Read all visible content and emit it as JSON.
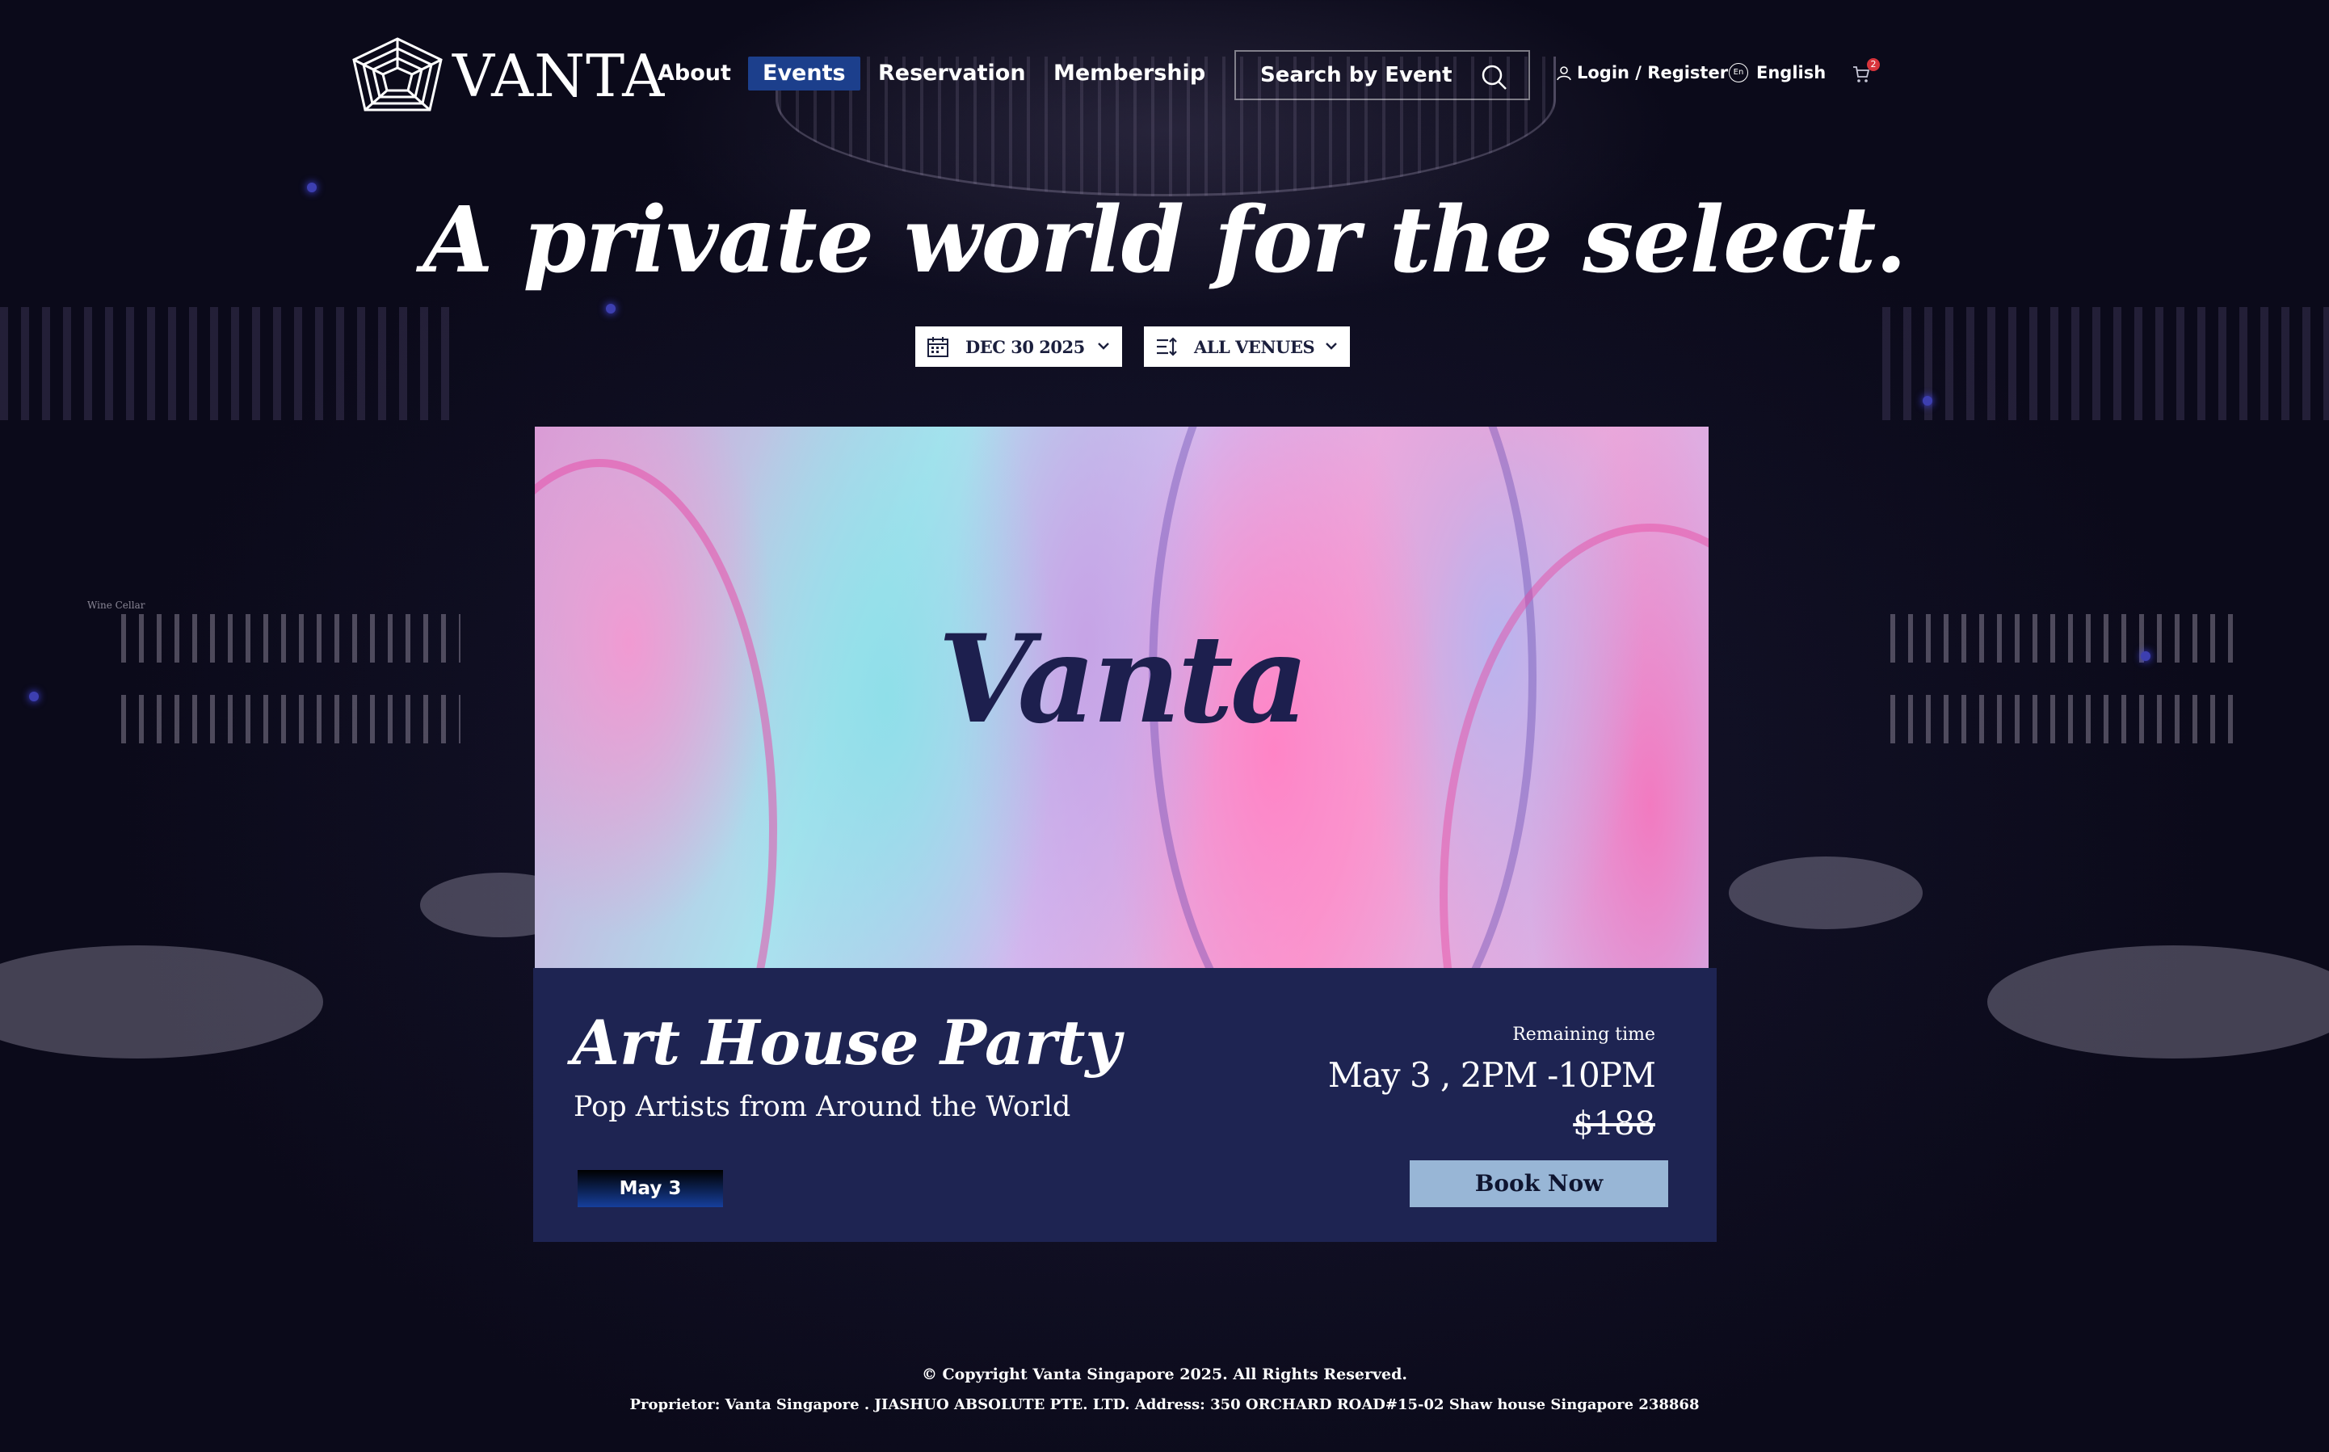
{
  "brand": {
    "name": "VANTA"
  },
  "nav": {
    "items": [
      {
        "label": "About"
      },
      {
        "label": "Events"
      },
      {
        "label": "Reservation"
      },
      {
        "label": "Membership"
      }
    ],
    "active": "Events",
    "search_label": "Search by Event",
    "login_label": "Login / Register",
    "language": "English",
    "language_badge": "En",
    "cart_count": "2"
  },
  "hero": {
    "title": "A private world for the select.",
    "date_filter": "DEC 30 2025",
    "venue_filter": "ALL VENUES"
  },
  "event": {
    "image_text": "Vanta",
    "title": "Art House Party",
    "subtitle": "Pop Artists from Around the World",
    "date_tag": "May 3",
    "remaining_label": "Remaining time",
    "time": "May 3 , 2PM -10PM",
    "price": "$188",
    "book_label": "Book Now"
  },
  "background": {
    "sign": "Wine Cellar"
  },
  "footer": {
    "copyright": "© Copyright Vanta Singapore 2025. All Rights Reserved.",
    "address": "Proprietor: Vanta Singapore . JIASHUO ABSOLUTE PTE. LTD.  Address: 350 ORCHARD ROAD#15-02 Shaw house  Singapore 238868"
  },
  "colors": {
    "accent": "#1c3f8c",
    "card_body": "#1e2452",
    "book_button": "#98b6d6",
    "page_bg": "#121126"
  }
}
